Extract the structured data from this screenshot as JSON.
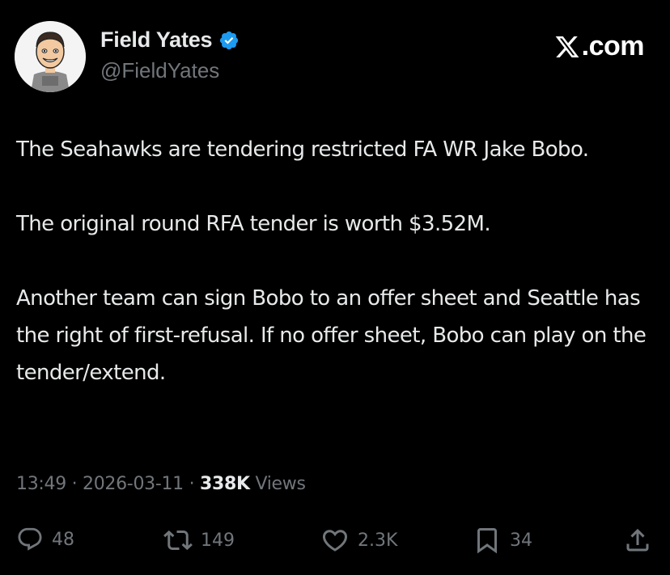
{
  "author": {
    "name": "Field Yates",
    "handle": "@FieldYates",
    "verified": true,
    "avatar_icon": "cartoon-avatar"
  },
  "brand": {
    "text": ".com",
    "icon": "x-logo-icon"
  },
  "tweet": {
    "paragraphs": [
      "The Seahawks are tendering restricted FA WR Jake Bobo.",
      "The original round RFA tender is worth $3.52M.",
      "Another team can sign Bobo to an offer sheet and Seattle has the right of first-refusal. If no offer sheet, Bobo can play on the tender/extend."
    ]
  },
  "meta": {
    "time": "13:49",
    "separator": "·",
    "date": "2026-03-11",
    "views_count": "338K",
    "views_label": "Views"
  },
  "actions": {
    "replies": "48",
    "reposts": "149",
    "likes": "2.3K",
    "bookmarks": "34"
  },
  "colors": {
    "background": "#000000",
    "text": "#e7e9ea",
    "secondary": "#71767b",
    "verified": "#1d9bf0"
  }
}
